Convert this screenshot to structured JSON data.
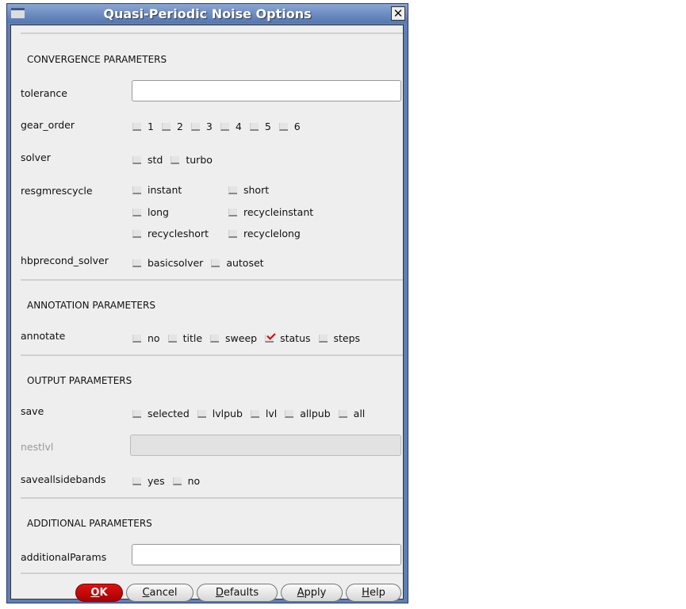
{
  "window": {
    "title": "Quasi-Periodic Noise Options"
  },
  "sections": {
    "convergence": "CONVERGENCE PARAMETERS",
    "annotation": "ANNOTATION PARAMETERS",
    "output": "OUTPUT PARAMETERS",
    "additional": "ADDITIONAL PARAMETERS"
  },
  "fields": {
    "tolerance": {
      "label": "tolerance",
      "value": ""
    },
    "gear_order": {
      "label": "gear_order",
      "options": [
        "1",
        "2",
        "3",
        "4",
        "5",
        "6"
      ]
    },
    "solver": {
      "label": "solver",
      "options": [
        "std",
        "turbo"
      ]
    },
    "resgmrescycle": {
      "label": "resgmrescycle",
      "options": [
        "instant",
        "short",
        "long",
        "recycleinstant",
        "recycleshort",
        "recyclelong"
      ]
    },
    "hbprecond_solver": {
      "label": "hbprecond_solver",
      "options": [
        "basicsolver",
        "autoset"
      ]
    },
    "annotate": {
      "label": "annotate",
      "options": [
        "no",
        "title",
        "sweep",
        "status",
        "steps"
      ],
      "checked": "status"
    },
    "save": {
      "label": "save",
      "options": [
        "selected",
        "lvlpub",
        "lvl",
        "allpub",
        "all"
      ]
    },
    "nestlvl": {
      "label": "nestlvl",
      "value": ""
    },
    "saveallsidebands": {
      "label": "saveallsidebands",
      "options": [
        "yes",
        "no"
      ]
    },
    "additionalParams": {
      "label": "additionalParams",
      "value": ""
    }
  },
  "buttons": {
    "ok": {
      "mn": "O",
      "rest": "K"
    },
    "cancel": {
      "mn": "C",
      "rest": "ancel"
    },
    "defaults": {
      "mn": "D",
      "rest": "efaults"
    },
    "apply": {
      "mn": "A",
      "rest": "pply"
    },
    "help": {
      "mn": "H",
      "rest": "elp"
    }
  },
  "colors": {
    "titlebar": "#5f7fb5",
    "ok": "#c00000",
    "check": "#dd0000"
  }
}
